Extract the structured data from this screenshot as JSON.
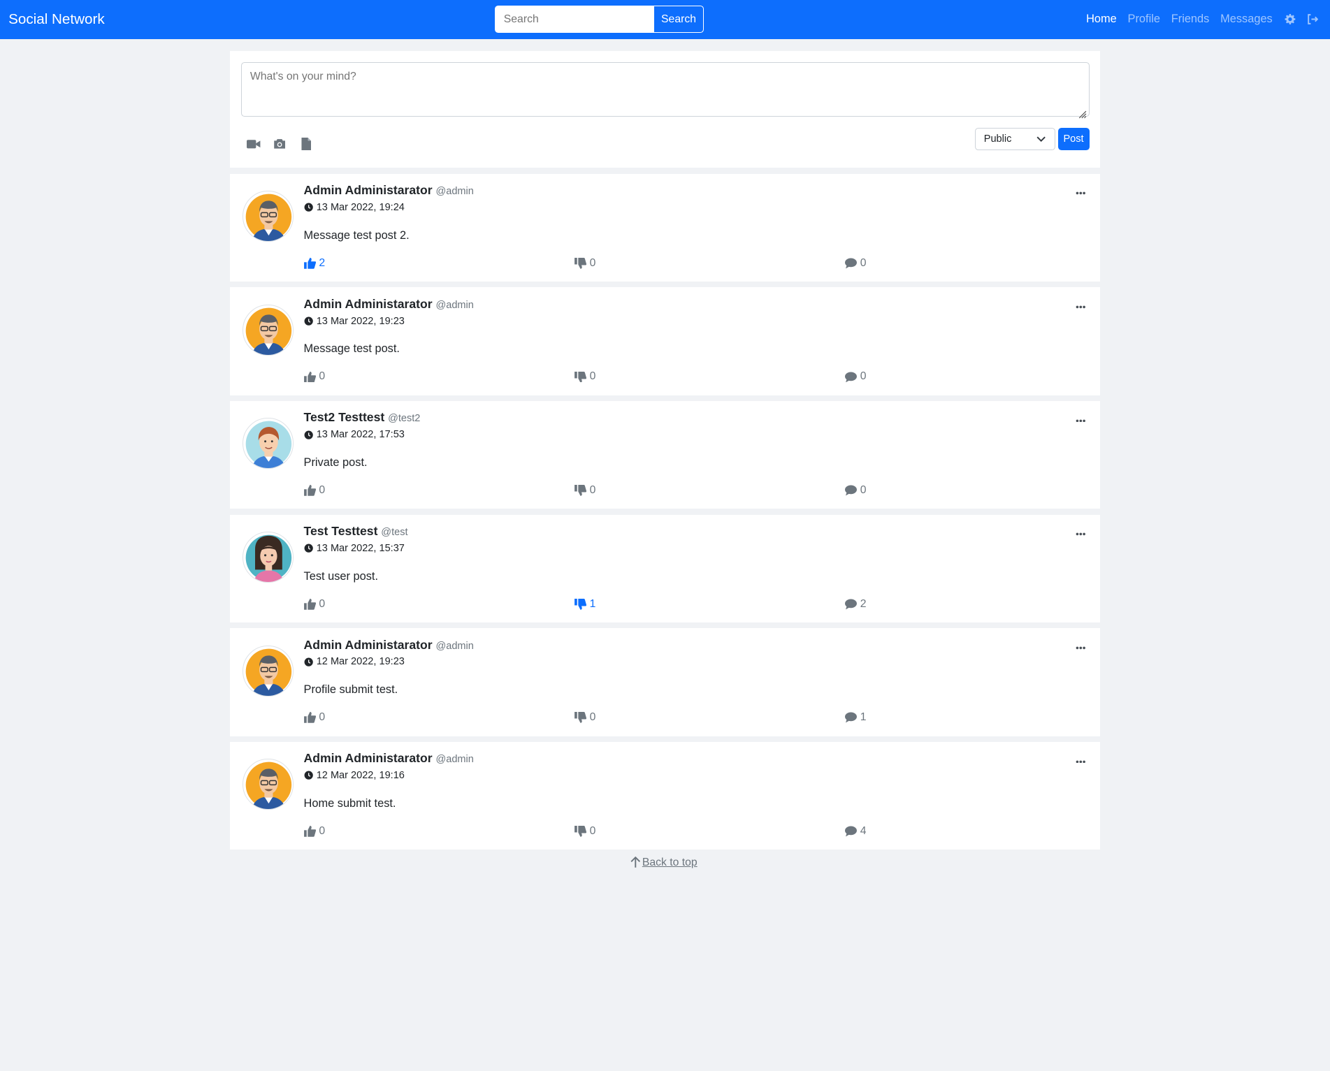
{
  "navbar": {
    "brand": "Social Network",
    "search_placeholder": "Search",
    "search_button": "Search",
    "links": [
      {
        "label": "Home",
        "active": true
      },
      {
        "label": "Profile",
        "active": false
      },
      {
        "label": "Friends",
        "active": false
      },
      {
        "label": "Messages",
        "active": false
      }
    ]
  },
  "composer": {
    "placeholder": "What's on your mind?",
    "visibility": "Public",
    "post_button": "Post"
  },
  "posts": [
    {
      "author": "Admin Administarator",
      "handle": "@admin",
      "time": "13 Mar 2022, 19:24",
      "message": "Message test post 2.",
      "likes": "2",
      "dislikes": "0",
      "comments": "0",
      "liked": true,
      "disliked": false,
      "avatar": "admin"
    },
    {
      "author": "Admin Administarator",
      "handle": "@admin",
      "time": "13 Mar 2022, 19:23",
      "message": "Message test post.",
      "likes": "0",
      "dislikes": "0",
      "comments": "0",
      "liked": false,
      "disliked": false,
      "avatar": "admin"
    },
    {
      "author": "Test2 Testtest",
      "handle": "@test2",
      "time": "13 Mar 2022, 17:53",
      "message": "Private post.",
      "likes": "0",
      "dislikes": "0",
      "comments": "0",
      "liked": false,
      "disliked": false,
      "avatar": "test2"
    },
    {
      "author": "Test Testtest",
      "handle": "@test",
      "time": "13 Mar 2022, 15:37",
      "message": "Test user post.",
      "likes": "0",
      "dislikes": "1",
      "comments": "2",
      "liked": false,
      "disliked": true,
      "avatar": "test"
    },
    {
      "author": "Admin Administarator",
      "handle": "@admin",
      "time": "12 Mar 2022, 19:23",
      "message": "Profile submit test.",
      "likes": "0",
      "dislikes": "0",
      "comments": "1",
      "liked": false,
      "disliked": false,
      "avatar": "admin"
    },
    {
      "author": "Admin Administarator",
      "handle": "@admin",
      "time": "12 Mar 2022, 19:16",
      "message": "Home submit test.",
      "likes": "0",
      "dislikes": "0",
      "comments": "4",
      "liked": false,
      "disliked": false,
      "avatar": "admin"
    }
  ],
  "footer": {
    "back_to_top": "Back to top"
  },
  "colors": {
    "primary": "#0d6efd",
    "background": "#f0f2f5",
    "muted": "#6c757d"
  },
  "icons": [
    "video-icon",
    "camera-icon",
    "file-icon",
    "gear-icon",
    "logout-icon",
    "clock-icon",
    "thumbs-up-icon",
    "thumbs-down-icon",
    "comment-icon",
    "more-icon",
    "arrow-up-icon",
    "chevron-down-icon"
  ]
}
